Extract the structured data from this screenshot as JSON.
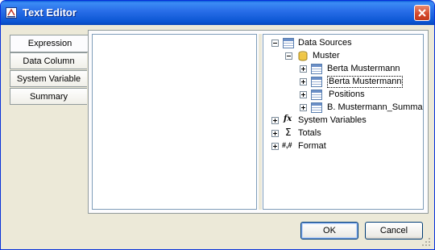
{
  "window": {
    "title": "Text Editor"
  },
  "tabs": [
    {
      "label": "Expression",
      "active": true
    },
    {
      "label": "Data Column"
    },
    {
      "label": "System Variable"
    },
    {
      "label": "Summary"
    }
  ],
  "editor": {
    "value": ""
  },
  "tree": {
    "root": {
      "label": "Data Sources",
      "icon": "table-icon"
    },
    "muster": {
      "label": "Muster",
      "icon": "database-icon"
    },
    "tables": [
      {
        "label": "Berta Mustermann",
        "icon": "table-icon"
      },
      {
        "label": "Berta Mustermann",
        "icon": "table-icon",
        "selected": true
      },
      {
        "label": "Positions",
        "icon": "table-icon"
      },
      {
        "label": "B. Mustermann_Summary",
        "icon": "table-icon"
      }
    ],
    "system_variables": {
      "label": "System Variables",
      "icon": "fx-icon",
      "glyph": "fx"
    },
    "totals": {
      "label": "Totals",
      "icon": "sigma-icon",
      "glyph": "Σ"
    },
    "format": {
      "label": "Format",
      "icon": "format-icon",
      "glyph": "#,#"
    }
  },
  "buttons": {
    "ok": "OK",
    "cancel": "Cancel"
  },
  "colors": {
    "title_bar": "#0a55d2",
    "close": "#d4472a",
    "dialog": "#ece9d8",
    "focus": "#7aa4e8"
  }
}
